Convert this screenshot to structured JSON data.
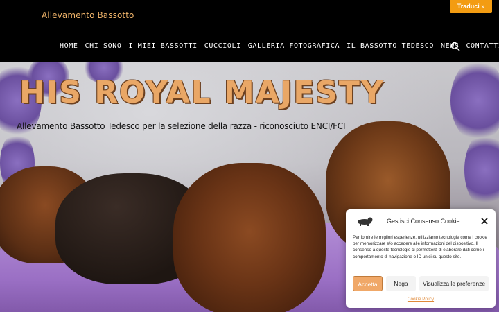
{
  "header": {
    "site_title": "Allevamento Bassotto",
    "translate_label": "Traduci »"
  },
  "nav": {
    "items": [
      "HOME",
      "CHI SONO",
      "I MIEI BASSOTTI",
      "CUCCIOLI",
      "GALLERIA FOTOGRAFICA",
      "IL BASSOTTO TEDESCO",
      "NEWS",
      "CONTATTI"
    ],
    "search_icon": "search-icon"
  },
  "hero": {
    "title": "HIS ROYAL MAJESTY",
    "subtitle": "Allevamento Bassotto Tedesco per la selezione della razza - riconosciuto ENCI/FCI"
  },
  "cookie": {
    "title": "Gestisci Consenso Cookie",
    "text": "Per fornire le migliori esperienze, utilizziamo tecnologie come i cookie per memorizzare e/o accedere alle informazioni del dispositivo. Il consenso a queste tecnologie ci permetterà di elaborare dati come il comportamento di navigazione o ID unici su questo sito.",
    "accept": "Accetta",
    "deny": "Nega",
    "preferences": "Visualizza le preferenze",
    "policy": "Cookie Policy"
  },
  "colors": {
    "accent": "#f39c12",
    "title_orange": "#e9a766",
    "header_bg": "#000000"
  }
}
